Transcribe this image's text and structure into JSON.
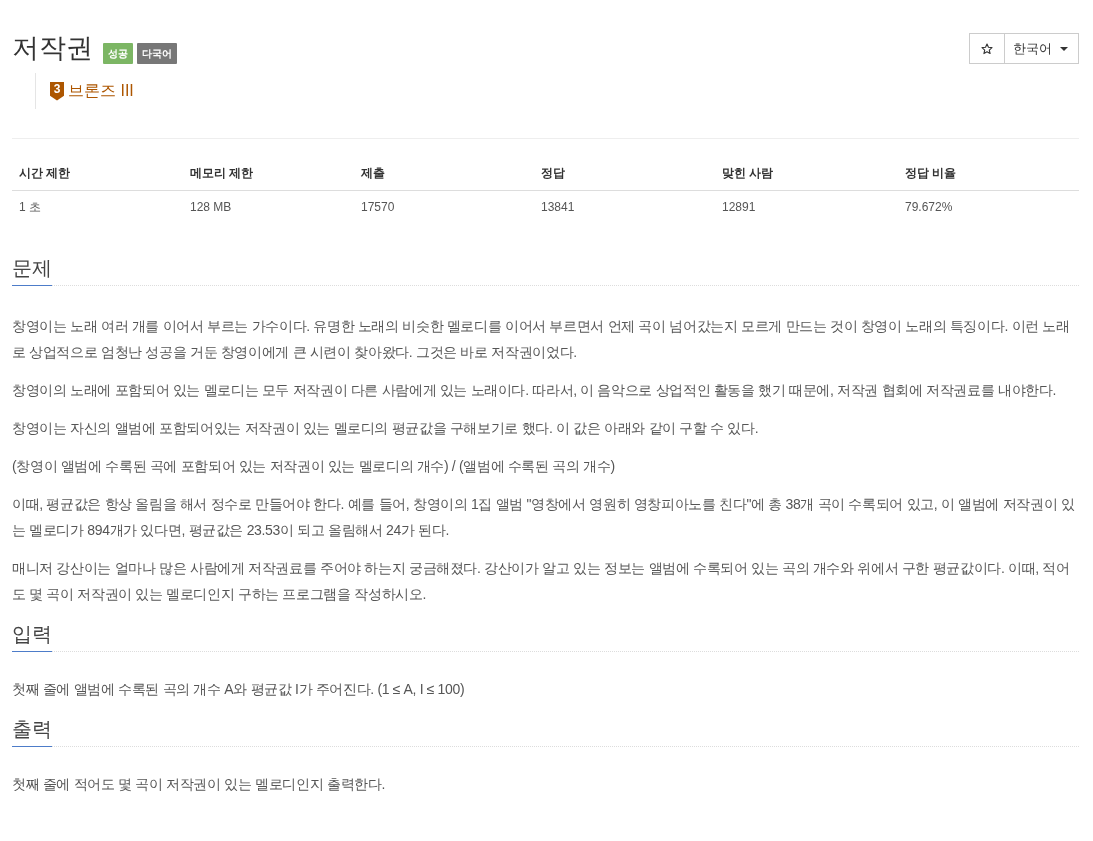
{
  "header": {
    "title": "저작권",
    "labels": [
      {
        "text": "성공",
        "kind": "success"
      },
      {
        "text": "다국어",
        "kind": "neutral"
      }
    ],
    "tier": {
      "badge": "3",
      "name": "브론즈 III"
    }
  },
  "actions": {
    "language": "한국어"
  },
  "stats_table": {
    "columns": [
      "시간 제한",
      "메모리 제한",
      "제출",
      "정답",
      "맞힌 사람",
      "정답 비율"
    ],
    "rows": [
      [
        "1 초",
        "128 MB",
        "17570",
        "13841",
        "12891",
        "79.672%"
      ]
    ]
  },
  "sections": [
    {
      "heading": "문제",
      "paragraphs": [
        "창영이는 노래 여러 개를 이어서 부르는 가수이다. 유명한 노래의 비슷한 멜로디를 이어서 부르면서 언제 곡이 넘어갔는지 모르게 만드는 것이 창영이 노래의 특징이다. 이런 노래로 상업적으로 엄청난 성공을 거둔 창영이에게 큰 시련이 찾아왔다. 그것은 바로 저작권이었다.",
        "창영이의 노래에 포함되어 있는 멜로디는 모두 저작권이 다른 사람에게 있는 노래이다. 따라서, 이 음악으로 상업적인 활동을 했기 때문에, 저작권 협회에 저작권료를 내야한다.",
        "창영이는 자신의 앨범에 포함되어있는 저작권이 있는 멜로디의 평균값을 구해보기로 했다. 이 값은 아래와 같이 구할 수 있다.",
        "(창영이 앨범에 수록된 곡에 포함되어 있는 저작권이 있는 멜로디의 개수) / (앨범에 수록된 곡의 개수)",
        "이때, 평균값은 항상 올림을 해서 정수로 만들어야 한다. 예를 들어, 창영이의 1집 앨범 \"영창에서 영원히 영창피아노를 친다\"에 총 38개 곡이 수록되어 있고, 이 앨범에 저작권이 있는 멜로디가 894개가 있다면, 평균값은 23.53이 되고 올림해서 24가 된다.",
        "매니저 강산이는 얼마나 많은 사람에게 저작권료를 주어야 하는지 궁금해졌다. 강산이가 알고 있는 정보는 앨범에 수록되어 있는 곡의 개수와 위에서 구한 평균값이다. 이때, 적어도 몇 곡이 저작권이 있는 멜로디인지 구하는 프로그램을 작성하시오."
      ]
    },
    {
      "heading": "입력",
      "paragraphs": [
        "첫째 줄에 앨범에 수록된 곡의 개수 A와 평균값 I가 주어진다. (1 ≤ A, I ≤ 100)"
      ]
    },
    {
      "heading": "출력",
      "paragraphs": [
        "첫째 줄에 적어도 몇 곡이 저작권이 있는 멜로디인지 출력한다."
      ]
    }
  ]
}
